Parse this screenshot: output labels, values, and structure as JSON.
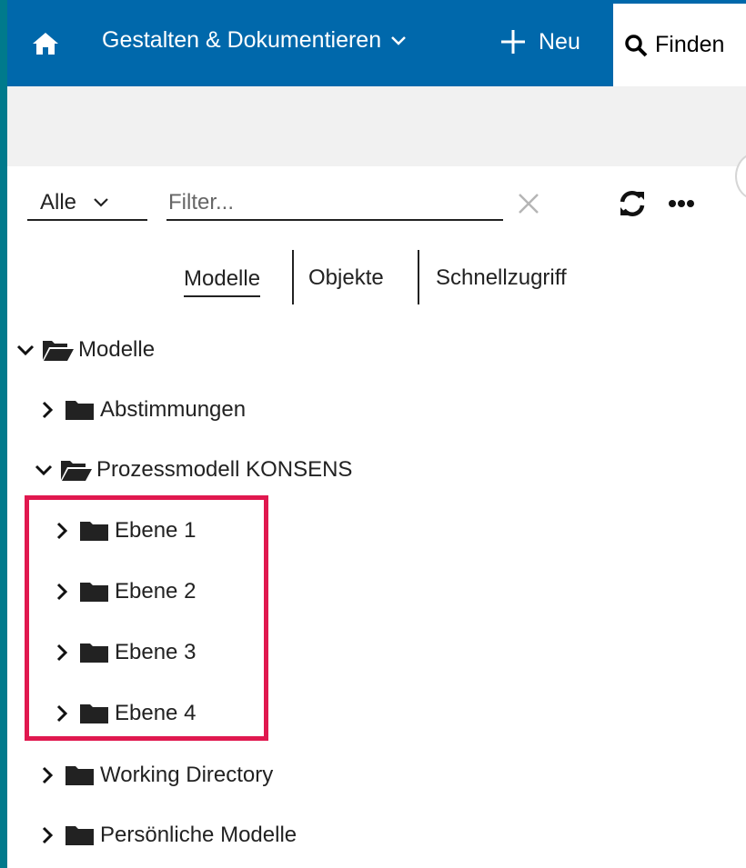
{
  "topbar": {
    "home_icon": "home-icon",
    "menu_label": "Gestalten & Dokumentieren",
    "new_label": "Neu",
    "find_label": "Finden",
    "colors": {
      "bar": "#0068ab",
      "edge": "#007a8c"
    }
  },
  "filter": {
    "scope_value": "Alle",
    "placeholder": "Filter..."
  },
  "tabs": {
    "modelle": "Modelle",
    "objekte": "Objekte",
    "schnellzugriff": "Schnellzugriff"
  },
  "tree": {
    "root": "Modelle",
    "abstimmungen": "Abstimmungen",
    "prozessmodell": "Prozessmodell KONSENS",
    "ebene1": "Ebene 1",
    "ebene2": "Ebene 2",
    "ebene3": "Ebene 3",
    "ebene4": "Ebene 4",
    "working": "Working Directory",
    "personal": "Persönliche Modelle"
  },
  "highlight_color": "#e0184f"
}
